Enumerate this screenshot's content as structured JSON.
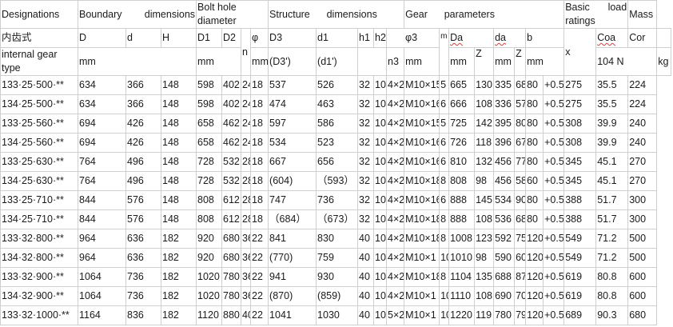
{
  "header": {
    "row1": {
      "designations": "Designations",
      "boundary": "Boundary      dimensions",
      "bolt_hole": "Bolt hole diameter",
      "structure": "Structure      dimensions",
      "gear": "Gear      parameters",
      "load": "Basic      load ratings",
      "mass": "Mass"
    },
    "row2": {
      "chinese": "内齿式",
      "D": "D",
      "d": "d",
      "H": "H",
      "D1": "D1",
      "D2": "D2",
      "n": "n",
      "phi": "φ",
      "D3": "D3",
      "d1": "d1",
      "h1": "h1",
      "h2": "h2",
      "phi3": "φ3",
      "Da": "Da",
      "da": "da",
      "b": "b",
      "Coa": "Coa",
      "Cor": "Cor"
    },
    "row3": {
      "gear_type": "internal gear   type",
      "mm1": "mm",
      "mm2": "mm",
      "mm3": "mm",
      "d3p": "(D3')",
      "d1p": "(d1')",
      "n3": "n3",
      "mm4": "mm",
      "m": "m",
      "mm5": "mm",
      "Z1": "Z",
      "mm6": "mm",
      "Z2": "Z",
      "mm7": "mm",
      "x": "x",
      "load_unit": "104 N",
      "kg": "kg"
    }
  },
  "rows": [
    {
      "type": "133·25·500·**",
      "D": "634",
      "d": "366",
      "H": "148",
      "D1": "598",
      "D2": "402",
      "n": "24",
      "phi": "18",
      "D3": "537",
      "d1": "526",
      "h1": "32",
      "h2": "10",
      "n3": "4×2",
      "phi3": "M10×15",
      "m": "5",
      "Da": "665",
      "Z": "130",
      "da": "335",
      "Z2": "68",
      "b": "80",
      "x": "+0.5",
      "Coa": "275",
      "Cor": "35.5",
      "mass": "224"
    },
    {
      "type": "134·25·500·**",
      "D": "634",
      "d": "366",
      "H": "148",
      "D1": "598",
      "D2": "402",
      "n": "24",
      "phi": "18",
      "D3": "474",
      "d1": "463",
      "h1": "32",
      "h2": "10",
      "n3": "4×2",
      "phi3": "M10×16",
      "m": "6",
      "Da": "666",
      "Z": "108",
      "da": "336",
      "Z2": "57",
      "b": "80",
      "x": "+0.5",
      "Coa": "275",
      "Cor": "35.5",
      "mass": "224"
    },
    {
      "type": "133·25·560·**",
      "D": "694",
      "d": "426",
      "H": "148",
      "D1": "658",
      "D2": "462",
      "n": "24",
      "phi": "18",
      "D3": "597",
      "d1": "586",
      "h1": "32",
      "h2": "10",
      "n3": "4×2",
      "phi3": "M10×15",
      "m": "5",
      "Da": "725",
      "Z": "142",
      "da": "395",
      "Z2": "80",
      "b": "80",
      "x": "+0.5",
      "Coa": "308",
      "Cor": "39.9",
      "mass": "240"
    },
    {
      "type": "134·25·560·**",
      "D": "694",
      "d": "426",
      "H": "148",
      "D1": "658",
      "D2": "462",
      "n": "24",
      "phi": "18",
      "D3": "534",
      "d1": "523",
      "h1": "32",
      "h2": "10",
      "n3": "4×2",
      "phi3": "M10×16",
      "m": "6",
      "Da": "726",
      "Z": "118",
      "da": "396",
      "Z2": "67",
      "b": "80",
      "x": "+0.5",
      "Coa": "308",
      "Cor": "39.9",
      "mass": "240"
    },
    {
      "type": "133·25·630·**",
      "D": "764",
      "d": "496",
      "H": "148",
      "D1": "728",
      "D2": "532",
      "n": "28",
      "phi": "18",
      "D3": "667",
      "d1": "656",
      "h1": "32",
      "h2": "10",
      "n3": "4×2",
      "phi3": "M10×16",
      "m": "6",
      "Da": "810",
      "Z": "132",
      "da": "456",
      "Z2": "77",
      "b": "80",
      "x": "+0.5",
      "Coa": "345",
      "Cor": "45.1",
      "mass": "270"
    },
    {
      "type": "134·25·630·**",
      "D": "764",
      "d": "496",
      "H": "148",
      "D1": "728",
      "D2": "532",
      "n": "28",
      "phi": "18",
      "D3": "(604)",
      "d1": "（593）",
      "h1": "32",
      "h2": "10",
      "n3": "4×2",
      "phi3": "M10×18",
      "m": "8",
      "Da": "808",
      "Z": "98",
      "da": "456",
      "Z2": "58",
      "b": "60",
      "x": "+0.5",
      "Coa": "345",
      "Cor": "45.1",
      "mass": "270"
    },
    {
      "type": "133·25·710·**",
      "D": "844",
      "d": "576",
      "H": "148",
      "D1": "808",
      "D2": "612",
      "n": "28",
      "phi": "18",
      "D3": "747",
      "d1": "736",
      "h1": "32",
      "h2": "10",
      "n3": "4×2",
      "phi3": "M10×16",
      "m": "6",
      "Da": "888",
      "Z": "145",
      "da": "534",
      "Z2": "90",
      "b": "80",
      "x": "+0.5",
      "Coa": "388",
      "Cor": "51.7",
      "mass": "300"
    },
    {
      "type": "134·25·710·**",
      "D": "844",
      "d": "576",
      "H": "148",
      "D1": "808",
      "D2": "612",
      "n": "28",
      "phi": "18",
      "D3": "（684）",
      "d1": "（673）",
      "h1": "32",
      "h2": "10",
      "n3": "4×2",
      "phi3": "M10×18",
      "m": "8",
      "Da": "888",
      "Z": "108",
      "da": "536",
      "Z2": "68",
      "b": "80",
      "x": "+0.5",
      "Coa": "388",
      "Cor": "51.7",
      "mass": "300"
    },
    {
      "type": "133·32·800·**",
      "D": "964",
      "d": "636",
      "H": "182",
      "D1": "920",
      "D2": "680",
      "n": "36",
      "phi": "22",
      "D3": "841",
      "d1": "830",
      "h1": "40",
      "h2": "10",
      "n3": "4×2",
      "phi3": "M10×18",
      "m": "8",
      "Da": "1008",
      "Z": "123",
      "da": "592",
      "Z2": "75",
      "b": "120",
      "x": "+0.5",
      "Coa": "549",
      "Cor": "71.2",
      "mass": "500"
    },
    {
      "type": "134·32·800·**",
      "D": "964",
      "d": "636",
      "H": "182",
      "D1": "920",
      "D2": "680",
      "n": "36",
      "phi": "22",
      "D3": "(770)",
      "d1": "759",
      "h1": "40",
      "h2": "10",
      "n3": "4×2",
      "phi3": "M10×1",
      "m": "10",
      "Da": "1010",
      "Z": "98",
      "da": "590",
      "Z2": "60",
      "b": "120",
      "x": "+0.5",
      "Coa": "549",
      "Cor": "71.2",
      "mass": "500"
    },
    {
      "type": "133·32·900·**",
      "D": "1064",
      "d": "736",
      "H": "182",
      "D1": "1020",
      "D2": "780",
      "n": "36",
      "phi": "22",
      "D3": "941",
      "d1": "930",
      "h1": "40",
      "h2": "10",
      "n3": "4×2",
      "phi3": "M10×18",
      "m": "8",
      "Da": "1104",
      "Z": "135",
      "da": "688",
      "Z2": "87",
      "b": "120",
      "x": "+0.5",
      "Coa": "619",
      "Cor": "80.8",
      "mass": "600"
    },
    {
      "type": "134·32·900·**",
      "D": "1064",
      "d": "736",
      "H": "182",
      "D1": "1020",
      "D2": "780",
      "n": "36",
      "phi": "22",
      "D3": "(870)",
      "d1": "(859)",
      "h1": "40",
      "h2": "10",
      "n3": "4×2",
      "phi3": "M10×1",
      "m": "10",
      "Da": "1110",
      "Z": "108",
      "da": "690",
      "Z2": "70",
      "b": "120",
      "x": "+0.5",
      "Coa": "619",
      "Cor": "80.8",
      "mass": "600"
    },
    {
      "type": "133·32·1000·**",
      "D": "1164",
      "d": "836",
      "H": "182",
      "D1": "1120",
      "D2": "880",
      "n": "40",
      "phi": "22",
      "D3": "1041",
      "d1": "1030",
      "h1": "40",
      "h2": "10",
      "n3": "5×2",
      "phi3": "M10×1",
      "m": "10",
      "Da": "1220",
      "Z": "119",
      "da": "780",
      "Z2": "79",
      "b": "120",
      "x": "+0.5",
      "Coa": "689",
      "Cor": "90.3",
      "mass": "680"
    }
  ]
}
